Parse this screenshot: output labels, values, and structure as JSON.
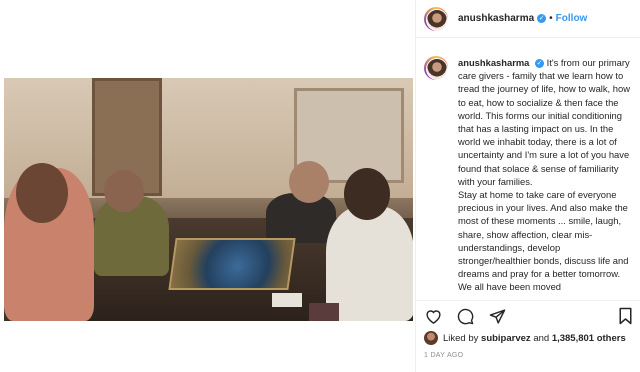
{
  "post": {
    "header": {
      "username": "anushkasharma",
      "separator": "•",
      "follow_label": "Follow"
    },
    "caption": {
      "username": "anushkasharma",
      "lines": [
        "It's from our primary care givers - family that we learn how to tread the journey of life, how to walk, how to eat, how to socialize & then face the world. This forms our initial conditioning that has a lasting impact on us. In the world we inhabit today, there is a lot of uncertainty and I'm sure a lot of you have found that solace & sense of familiarity with your families.",
        "Stay at home to take care of everyone precious in your lives. And also make the most of these moments ... smile, laugh, share, show affection, clear mis-understandings, develop stronger/healthier bonds, discuss life and dreams and pray for a better tomorrow. We all have been moved"
      ]
    },
    "likes": {
      "prefix": "Liked by",
      "liker": "subiparvez",
      "joiner": "and",
      "count": "1,385,801 others"
    },
    "timestamp": "1 DAY AGO",
    "icons": {
      "like": "heart-icon",
      "comment": "comment-icon",
      "share": "share-icon",
      "save": "bookmark-icon",
      "verified": "verified-badge-icon"
    },
    "colors": {
      "link": "#3897f0",
      "text": "#262626",
      "muted": "#8e8e8e"
    }
  }
}
